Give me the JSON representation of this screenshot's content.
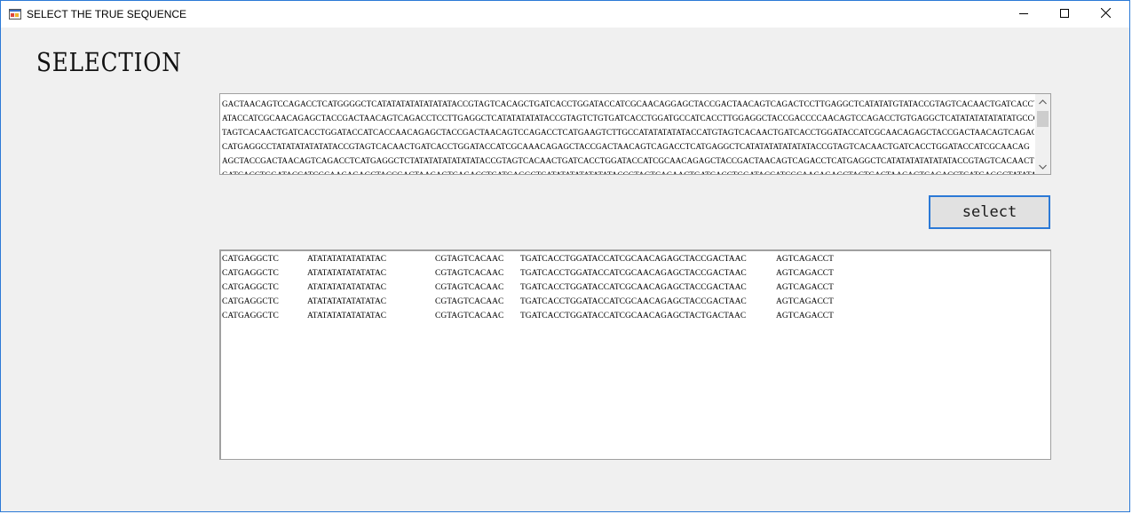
{
  "window": {
    "title": "SELECT THE TRUE SEQUENCE",
    "icons": {
      "app": "form-app-icon",
      "minimize": "minimize-icon",
      "maximize": "maximize-icon",
      "close": "close-icon"
    }
  },
  "heading": "SELECTION",
  "sequence_box": {
    "lines": [
      "GACTAACAGTCCAGACCTCATGGGGCTCATATATATATATATATACCGTAGTCACAGCTGATCACCTGGATACCATCGCAACAGGAGCTACCGACTAACAGTCAGACTCCTTGAGGCTCATATATGTATACCGTAGTCACAACTGATCACCTGG",
      "ATACCATCGCAACAGAGCTACCGACTAACAGTCAGACCTCCTTGAGGCTCATATATATATACCGTAGTCTGTGATCACCTGGATGCCATCACCTTGGAGGCTACCGACCCCAACAGTCCAGACCTGTGAGGCTCATATATATATATATGCCG",
      "TAGTCACAACTGATCACCTGGATACCATCACCAACAGAGCTACCGACTAACAGTCCAGACCTCATGAAGTCTTGCCATATATATATACCATGTAGTCACAACTGATCACCTGGATACCATCGCAACAGAGCTACCGACTAACAGTCAGACCT",
      "CATGAGGCCTATATATATATATACCGTAGTCACAACTGATCACCTGGATACCATCGCAAACAGAGCTACCGACTAACAGTCAGACCTCATGAGGCTCATATATATATATATACCGTAGTCACAACTGATCACCTGGATACCATCGCAACAG",
      "AGCTACCGACTAACAGTCAGACCTCATGAGGCTCTATATATATATATATACCGTAGTCACAACTGATCACCTGGATACCATCGCAACAGAGCTACCGACTAACAGTCAGACCTCATGAGGCTCATATATATATATATACCGTAGTCACAACT",
      "GATCACCTGGATACCATCGCAACAGAGCTACCGACTAACAGTCAGACCTCATGAGGCTCATATATATATATATACCGTAGTCACAACTGATCACCTGGATACCATCGCAACAGAGCTACTGACTAACAGTCAGACCTCATGAGGCTATATAT"
    ],
    "scroll_up_icon": "scroll-up-arrow-icon",
    "scroll_down_icon": "scroll-down-arrow-icon"
  },
  "select_button": {
    "label": "select"
  },
  "results": {
    "rows": [
      [
        "CATGAGGCTC",
        "ATATATATATATATAC",
        "CGTAGTCACAAC",
        "TGATCACCTGGATACCATCGCAACAGAGCTACCGACTAAC",
        "AGTCAGACCT"
      ],
      [
        "CATGAGGCTC",
        "ATATATATATATATAC",
        "CGTAGTCACAAC",
        "TGATCACCTGGATACCATCGCAACAGAGCTACCGACTAAC",
        "AGTCAGACCT"
      ],
      [
        "CATGAGGCTC",
        "ATATATATATATATAC",
        "CGTAGTCACAAC",
        "TGATCACCTGGATACCATCGCAACAGAGCTACCGACTAAC",
        "AGTCAGACCT"
      ],
      [
        "CATGAGGCTC",
        "ATATATATATATATAC",
        "CGTAGTCACAAC",
        "TGATCACCTGGATACCATCGCAACAGAGCTACCGACTAAC",
        "AGTCAGACCT"
      ],
      [
        "CATGAGGCTC",
        "ATATATATATATATAC",
        "CGTAGTCACAAC",
        "TGATCACCTGGATACCATCGCAACAGAGCTACTGACTAAC",
        "AGTCAGACCT"
      ]
    ]
  },
  "colors": {
    "window_border": "#2b79d6",
    "client_background": "#f0f0f0",
    "button_face": "#e1e1e1"
  }
}
